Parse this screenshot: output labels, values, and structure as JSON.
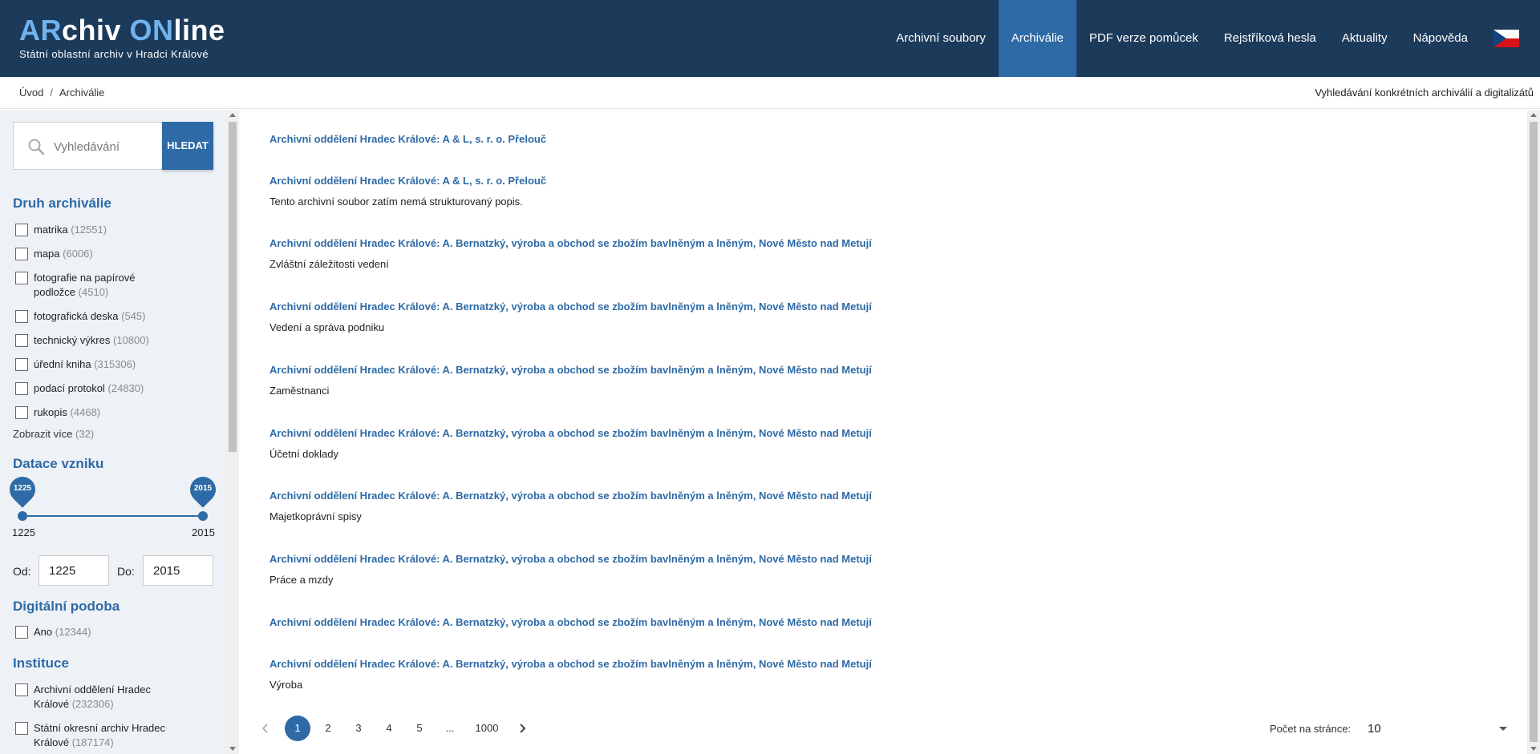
{
  "header": {
    "logo_part1": "AR",
    "logo_part2": "chiv ",
    "logo_part3": "ON",
    "logo_part4": "line",
    "subtitle": "Státní oblastní archiv v Hradci Králové",
    "nav": [
      "Archivní soubory",
      "Archiválie",
      "PDF verze pomůcek",
      "Rejstříková hesla",
      "Aktuality",
      "Nápověda"
    ],
    "active_nav": "Archiválie",
    "flag_icon": "czech-flag-icon"
  },
  "breadcrumb": {
    "home": "Úvod",
    "separator": "/",
    "current": "Archiválie",
    "right_text": "Vyhledávání konkrétních archiválií a digitalizátů"
  },
  "search": {
    "placeholder": "Vyhledávání",
    "button": "HLEDAT"
  },
  "filters": {
    "druh": {
      "heading": "Druh archiválie",
      "items": [
        {
          "label": "matrika",
          "count": "(12551)"
        },
        {
          "label": "mapa",
          "count": "(6006)"
        },
        {
          "label": "fotografie na papírové podložce",
          "count": "(4510)"
        },
        {
          "label": "fotografická deska",
          "count": "(545)"
        },
        {
          "label": "technický výkres",
          "count": "(10800)"
        },
        {
          "label": "úřední kniha",
          "count": "(315306)"
        },
        {
          "label": "podací protokol",
          "count": "(24830)"
        },
        {
          "label": "rukopis",
          "count": "(4468)"
        }
      ],
      "more": "Zobrazit více",
      "more_count": "(32)"
    },
    "datace": {
      "heading": "Datace vzniku",
      "min": "1225",
      "max": "2015",
      "from_label": "Od:",
      "to_label": "Do:",
      "from_value": "1225",
      "to_value": "2015"
    },
    "digitalni": {
      "heading": "Digitální podoba",
      "items": [
        {
          "label": "Ano",
          "count": "(12344)"
        }
      ]
    },
    "instituce": {
      "heading": "Instituce",
      "items": [
        {
          "label": "Archivní oddělení Hradec Králové",
          "count": "(232306)"
        },
        {
          "label": "Státní okresní archiv Hradec Králové",
          "count": "(187174)"
        }
      ]
    }
  },
  "results": [
    {
      "title": "Archivní oddělení Hradec Králové: A & L, s. r. o. Přelouč",
      "desc": ""
    },
    {
      "title": "Archivní oddělení Hradec Králové: A & L, s. r. o. Přelouč",
      "desc": "Tento archivní soubor zatím nemá strukturovaný popis."
    },
    {
      "title": "Archivní oddělení Hradec Králové: A. Bernatzký, výroba a obchod se zbožím bavlněným a lněným, Nové Město nad Metují",
      "desc": "Zvláštní záležitosti vedení"
    },
    {
      "title": "Archivní oddělení Hradec Králové: A. Bernatzký, výroba a obchod se zbožím bavlněným a lněným, Nové Město nad Metují",
      "desc": "Vedení a správa podniku"
    },
    {
      "title": "Archivní oddělení Hradec Králové: A. Bernatzký, výroba a obchod se zbožím bavlněným a lněným, Nové Město nad Metují",
      "desc": "Zaměstnanci"
    },
    {
      "title": "Archivní oddělení Hradec Králové: A. Bernatzký, výroba a obchod se zbožím bavlněným a lněným, Nové Město nad Metují",
      "desc": "Účetní doklady"
    },
    {
      "title": "Archivní oddělení Hradec Králové: A. Bernatzký, výroba a obchod se zbožím bavlněným a lněným, Nové Město nad Metují",
      "desc": "Majetkoprávní spisy"
    },
    {
      "title": "Archivní oddělení Hradec Králové: A. Bernatzký, výroba a obchod se zbožím bavlněným a lněným, Nové Město nad Metují",
      "desc": "Práce a mzdy"
    },
    {
      "title": "Archivní oddělení Hradec Králové: A. Bernatzký, výroba a obchod se zbožím bavlněným a lněným, Nové Město nad Metují",
      "desc": ""
    },
    {
      "title": "Archivní oddělení Hradec Králové: A. Bernatzký, výroba a obchod se zbožím bavlněným a lněným, Nové Město nad Metují",
      "desc": "Výroba"
    }
  ],
  "pagination": {
    "prev_icon": "chevron-left-icon",
    "next_icon": "chevron-right-icon",
    "pages": [
      "1",
      "2",
      "3",
      "4",
      "5",
      "...",
      "1000"
    ],
    "active": "1",
    "per_page_label": "Počet na stránce:",
    "per_page_value": "10"
  },
  "colors": {
    "header_bg": "#1c3a5a",
    "accent": "#2e6aa6",
    "logo_highlight": "#6fb3ee"
  }
}
